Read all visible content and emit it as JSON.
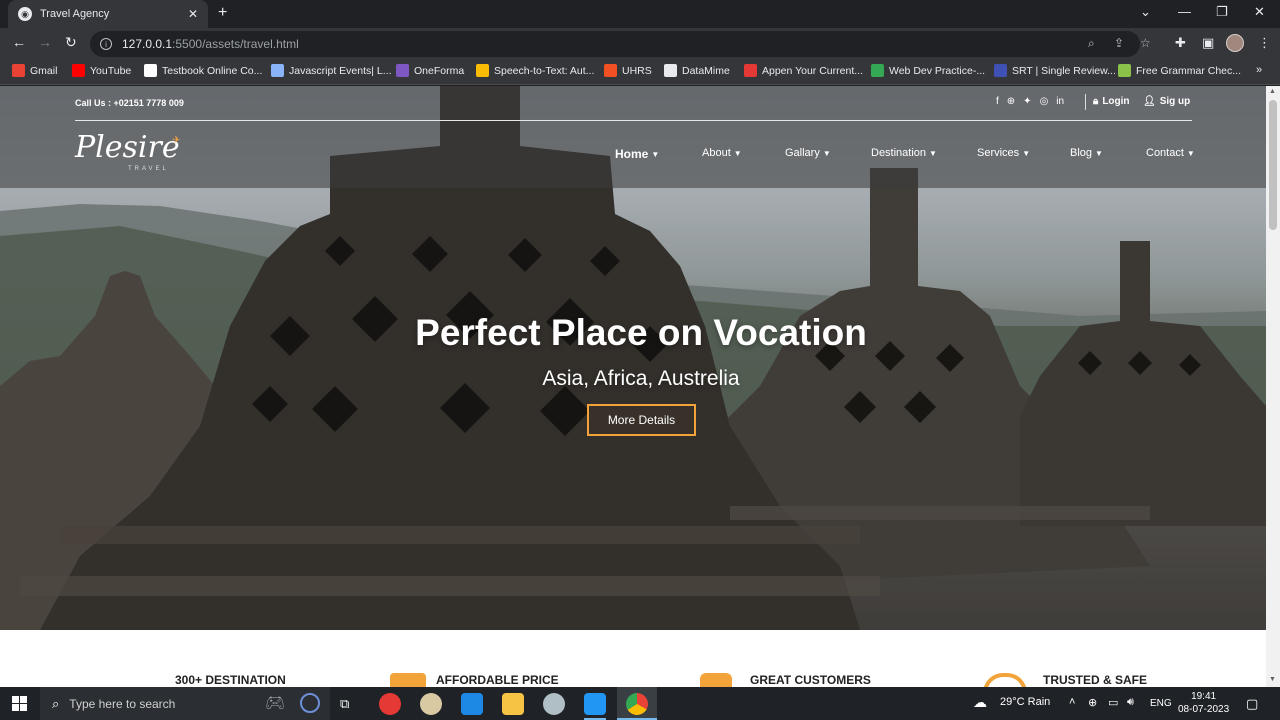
{
  "browser": {
    "tab_title": "Travel Agency",
    "tab_favicon": "globe-icon",
    "url_host": "127.0.0.1",
    "url_path": ":5500/assets/travel.html",
    "bookmarks": [
      {
        "label": "Gmail",
        "color": "#ea4335"
      },
      {
        "label": "YouTube",
        "color": "#ff0000"
      },
      {
        "label": "Testbook Online Co...",
        "color": "#ffffff"
      },
      {
        "label": "Javascript Events| L...",
        "color": "#8ab4f8"
      },
      {
        "label": "OneForma",
        "color": "#7e57c2"
      },
      {
        "label": "Speech-to-Text: Aut...",
        "color": "#fbbc04"
      },
      {
        "label": "UHRS",
        "color": "#f25022"
      },
      {
        "label": "DataMime",
        "color": "#e8eaed"
      },
      {
        "label": "Appen Your Current...",
        "color": "#e53935"
      },
      {
        "label": "Web Dev Practice-...",
        "color": "#34a853"
      },
      {
        "label": "SRT | Single Review...",
        "color": "#3f51b5"
      },
      {
        "label": "Free Grammar Chec...",
        "color": "#8bc34a"
      }
    ]
  },
  "site": {
    "call": "Call Us : +02151 7778 009",
    "login": "Login",
    "signup": "Sig up",
    "logo": "Plesire",
    "logo_sub": "TRAVEL",
    "menu": [
      {
        "label": "Home",
        "active": true
      },
      {
        "label": "About",
        "active": false
      },
      {
        "label": "Gallary",
        "active": false
      },
      {
        "label": "Destination",
        "active": false
      },
      {
        "label": "Services",
        "active": false
      },
      {
        "label": "Blog",
        "active": false
      },
      {
        "label": "Contact",
        "active": false
      }
    ],
    "hero_title": "Perfect Place on Vocation",
    "hero_subtitle": "Asia, Africa, Austrelia",
    "hero_button": "More Details",
    "features": [
      {
        "label": "300+ DESTINATION"
      },
      {
        "label": "AFFORDABLE PRICE"
      },
      {
        "label": "GREAT CUSTOMERS"
      },
      {
        "label": "TRUSTED & SAFE"
      }
    ],
    "accent_color": "#f2a33a"
  },
  "taskbar": {
    "search_placeholder": "Type here to search",
    "weather": "29°C  Rain",
    "language": "ENG",
    "time": "19:41",
    "date": "08-07-2023"
  }
}
